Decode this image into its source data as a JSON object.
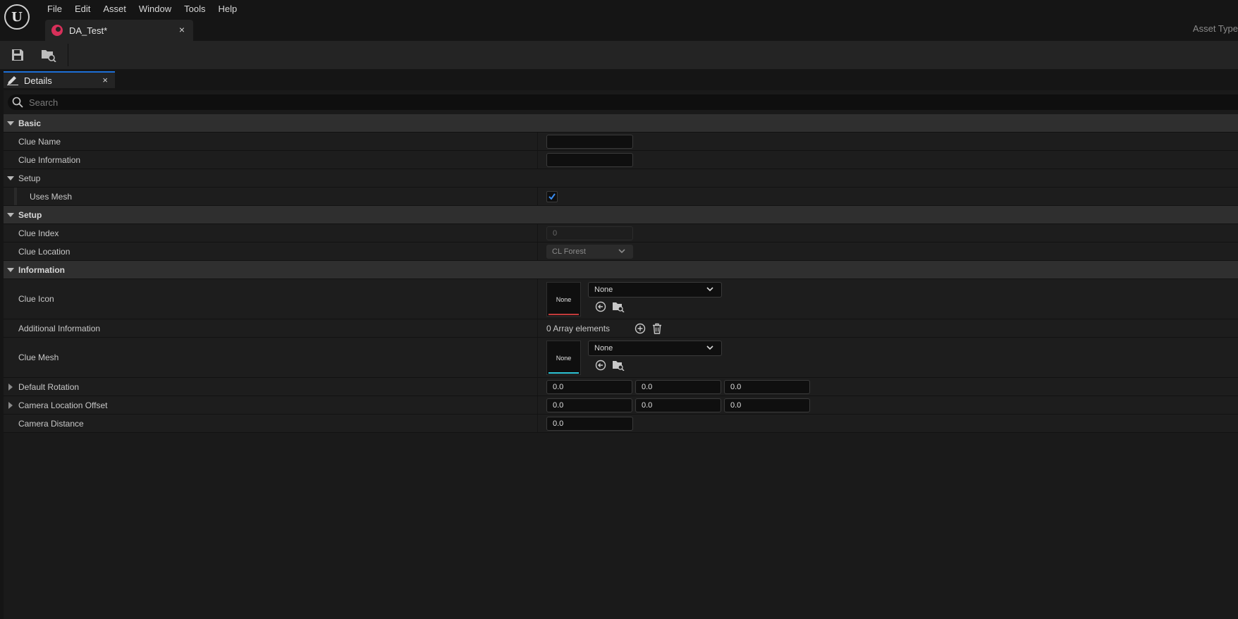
{
  "menu": [
    "File",
    "Edit",
    "Asset",
    "Window",
    "Tools",
    "Help"
  ],
  "document_tab": {
    "label": "DA_Test*",
    "close": "×"
  },
  "asset_type_label": "Asset Type",
  "details_tab": {
    "label": "Details",
    "close": "×"
  },
  "search": {
    "placeholder": "Search",
    "value": ""
  },
  "categories": {
    "basic": "Basic",
    "setup1": "Setup",
    "setup2": "Setup",
    "information": "Information"
  },
  "properties": {
    "clue_name": {
      "label": "Clue Name",
      "value": ""
    },
    "clue_information": {
      "label": "Clue Information",
      "value": ""
    },
    "uses_mesh": {
      "label": "Uses Mesh",
      "checked": true
    },
    "clue_index": {
      "label": "Clue Index",
      "value": "0"
    },
    "clue_location": {
      "label": "Clue Location",
      "value": "CL Forest"
    },
    "clue_icon": {
      "label": "Clue Icon",
      "thumb": "None",
      "selected": "None",
      "accent": "#c23b3b"
    },
    "additional_information": {
      "label": "Additional Information",
      "value": "0 Array elements"
    },
    "clue_mesh": {
      "label": "Clue Mesh",
      "thumb": "None",
      "selected": "None",
      "accent": "#2fc6d8"
    },
    "default_rotation": {
      "label": "Default Rotation",
      "x": "0.0",
      "y": "0.0",
      "z": "0.0"
    },
    "camera_location_offset": {
      "label": "Camera Location Offset",
      "x": "0.0",
      "y": "0.0",
      "z": "0.0"
    },
    "camera_distance": {
      "label": "Camera Distance",
      "value": "0.0"
    }
  },
  "colors": {
    "accent_blue": "#1d6fd6",
    "tab_icon": "#d8305a"
  }
}
